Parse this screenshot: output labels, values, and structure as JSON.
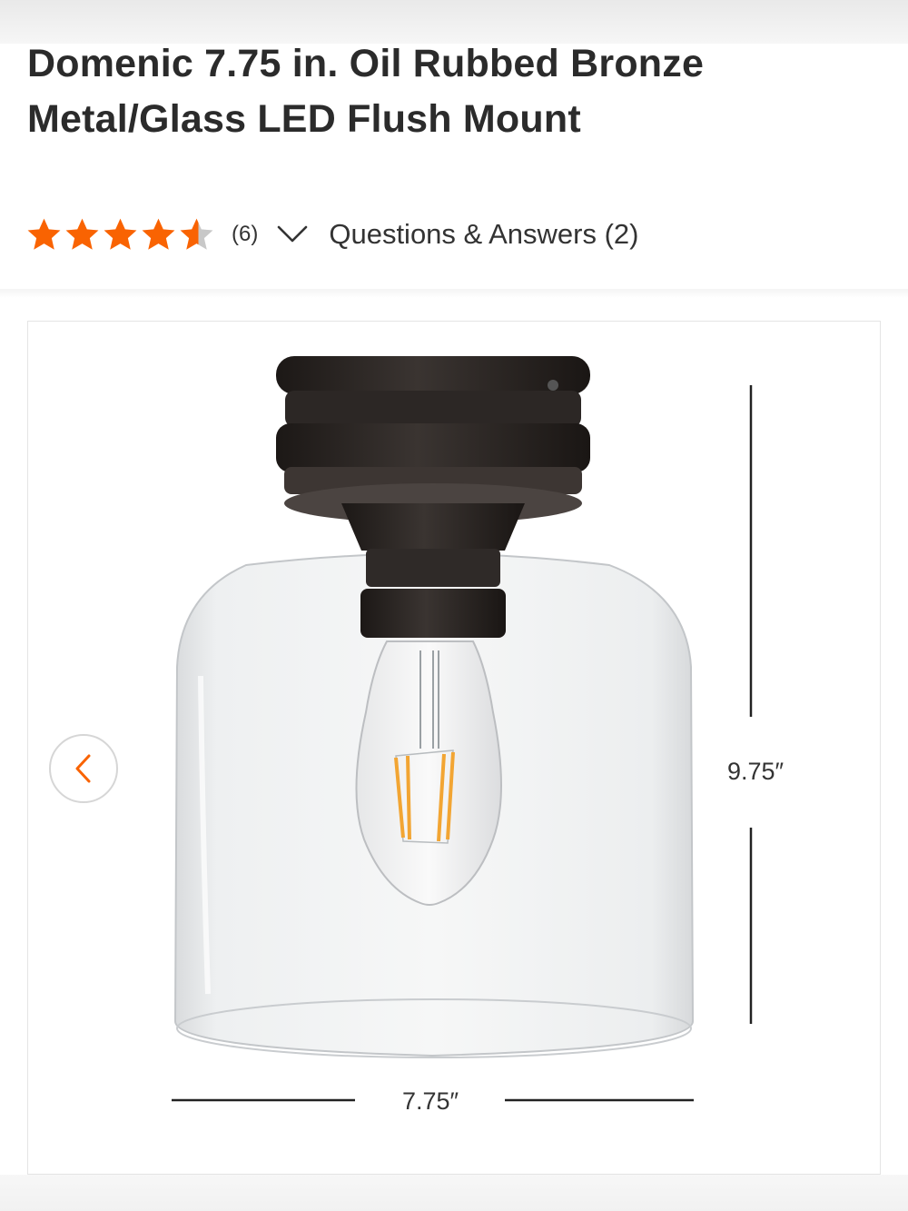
{
  "product": {
    "title": "Domenic 7.75 in. Oil Rubbed Bronze Metal/Glass LED Flush Mount",
    "rating": 4.5,
    "rating_max": 5,
    "review_count": "(6)",
    "qa_link": "Questions & Answers (2)"
  },
  "gallery": {
    "height_dimension": "9.75″",
    "width_dimension": "7.75″",
    "prev_icon": "chevron-left-icon"
  },
  "colors": {
    "star": "#f96302",
    "star_empty": "#c8c8c8",
    "prev_chevron": "#f96302",
    "fixture_bronze": "#2a2523"
  }
}
